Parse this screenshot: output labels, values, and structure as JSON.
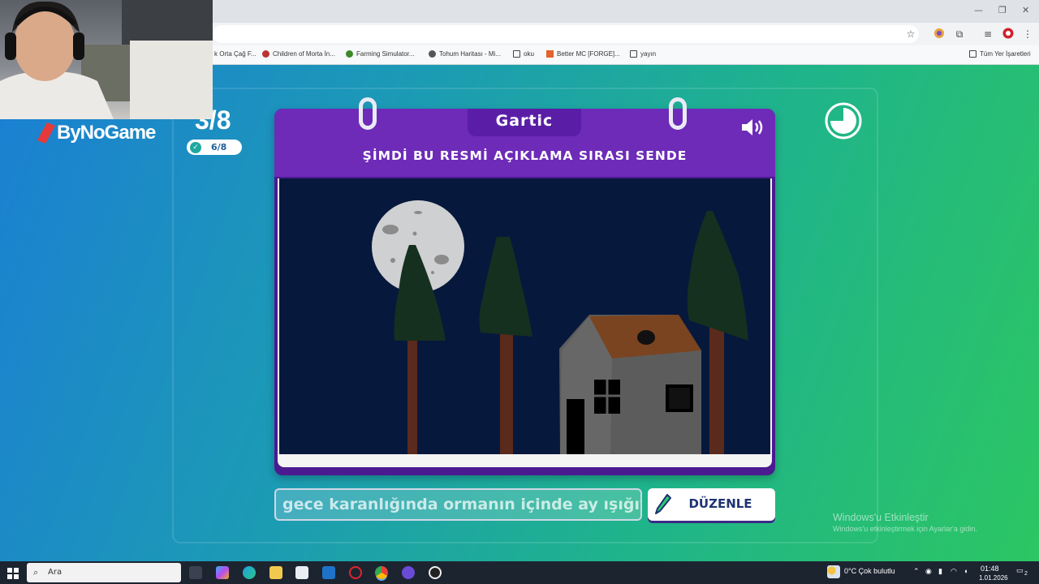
{
  "browser": {
    "bookmarks": [
      {
        "label": "k Orta Çağ F...",
        "icon": "generic-favicon"
      },
      {
        "label": "Children of Morta İn...",
        "icon": "steam-favicon"
      },
      {
        "label": "Farming Simulator...",
        "icon": "farming-favicon"
      },
      {
        "label": "Tohum Haritası - Mi...",
        "icon": "map-favicon"
      },
      {
        "label": "oku",
        "icon": "folder-icon"
      },
      {
        "label": "Better MC [FORGE]...",
        "icon": "curseforge-favicon"
      },
      {
        "label": "yayın",
        "icon": "folder-icon"
      }
    ],
    "all_bookmarks": "Tüm Yer İşaretleri"
  },
  "overlay": {
    "brand": "ByNoGame"
  },
  "game": {
    "round_display": "3/8",
    "done_count": "6/8",
    "logo": "Gartic",
    "prompt": "ŞİMDİ BU RESMİ AÇIKLAMA SIRASI SENDE",
    "answer_text": "gece karanlığında ormanın içinde ay ışığıyl",
    "edit_button": "DÜZENLE",
    "timer_remaining_fraction": 0.75
  },
  "watermark": {
    "line1": "Windows'u Etkinleştir",
    "line2": "Windows'u etkinleştirmek için Ayarlar'a gidin."
  },
  "taskbar": {
    "search_placeholder": "Ara",
    "weather": "0°C  Çok bulutlu",
    "time": "01:48",
    "date": "1.01.2026",
    "notification_count": "2"
  },
  "colors": {
    "card_purple": "#6d2bb8",
    "canvas_bg": "#07183d",
    "button_text": "#1d3373"
  }
}
